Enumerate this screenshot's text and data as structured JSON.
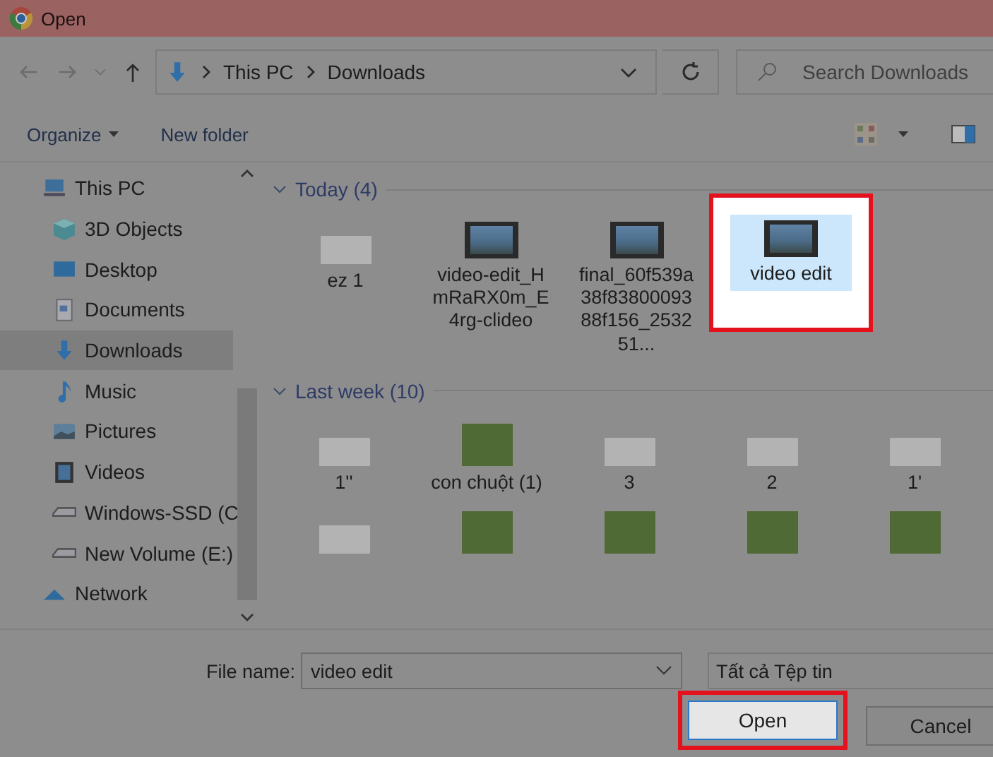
{
  "window": {
    "title": "Open"
  },
  "address": {
    "path": [
      "This PC",
      "Downloads"
    ]
  },
  "search": {
    "placeholder": "Search Downloads"
  },
  "toolbar": {
    "organize": "Organize",
    "new_folder": "New folder"
  },
  "sidebar": {
    "items": [
      {
        "label": "This PC",
        "kind": "pc",
        "selected": false,
        "children": [
          {
            "label": "3D Objects",
            "kind": "cube",
            "selected": false
          },
          {
            "label": "Desktop",
            "kind": "desktop",
            "selected": false
          },
          {
            "label": "Documents",
            "kind": "document",
            "selected": false
          },
          {
            "label": "Downloads",
            "kind": "download",
            "selected": true
          },
          {
            "label": "Music",
            "kind": "music",
            "selected": false
          },
          {
            "label": "Pictures",
            "kind": "picture",
            "selected": false
          },
          {
            "label": "Videos",
            "kind": "video",
            "selected": false
          },
          {
            "label": "Windows-SSD (C",
            "kind": "drive",
            "selected": false
          },
          {
            "label": "New Volume (E:)",
            "kind": "drive",
            "selected": false
          }
        ]
      },
      {
        "label": "Network",
        "kind": "network",
        "selected": false
      }
    ]
  },
  "groups": [
    {
      "label": "Today (4)",
      "items": [
        {
          "name": "ez 1",
          "kind": "doc",
          "selected": false,
          "highlighted": false
        },
        {
          "name": "video-edit_HmRaRX0m_E4rg-clideo",
          "kind": "video",
          "selected": false,
          "highlighted": false
        },
        {
          "name": "final_60f539a38f8380009388f156_253251...",
          "kind": "video",
          "selected": false,
          "highlighted": false
        },
        {
          "name": "video edit",
          "kind": "video",
          "selected": true,
          "highlighted": true
        }
      ]
    },
    {
      "label": "Last week (10)",
      "items": [
        {
          "name": "1''",
          "kind": "doc",
          "selected": false,
          "highlighted": false
        },
        {
          "name": "con chuột (1)",
          "kind": "photo",
          "selected": false,
          "highlighted": false
        },
        {
          "name": "3",
          "kind": "doc",
          "selected": false,
          "highlighted": false
        },
        {
          "name": "2",
          "kind": "doc",
          "selected": false,
          "highlighted": false
        },
        {
          "name": "1'",
          "kind": "doc",
          "selected": false,
          "highlighted": false
        },
        {
          "kind": "doc",
          "selected": false,
          "highlighted": false
        },
        {
          "kind": "photo",
          "selected": false,
          "highlighted": false
        },
        {
          "kind": "photo",
          "selected": false,
          "highlighted": false
        },
        {
          "kind": "photo",
          "selected": false,
          "highlighted": false
        },
        {
          "kind": "photo",
          "selected": false,
          "highlighted": false
        }
      ]
    }
  ],
  "footer": {
    "file_name_label": "File name:",
    "file_name": "video edit",
    "file_type": "Tất cả Tệp tin",
    "buttons": [
      {
        "label": "Open",
        "highlighted": true
      },
      {
        "label": "Cancel",
        "highlighted": false
      }
    ]
  }
}
